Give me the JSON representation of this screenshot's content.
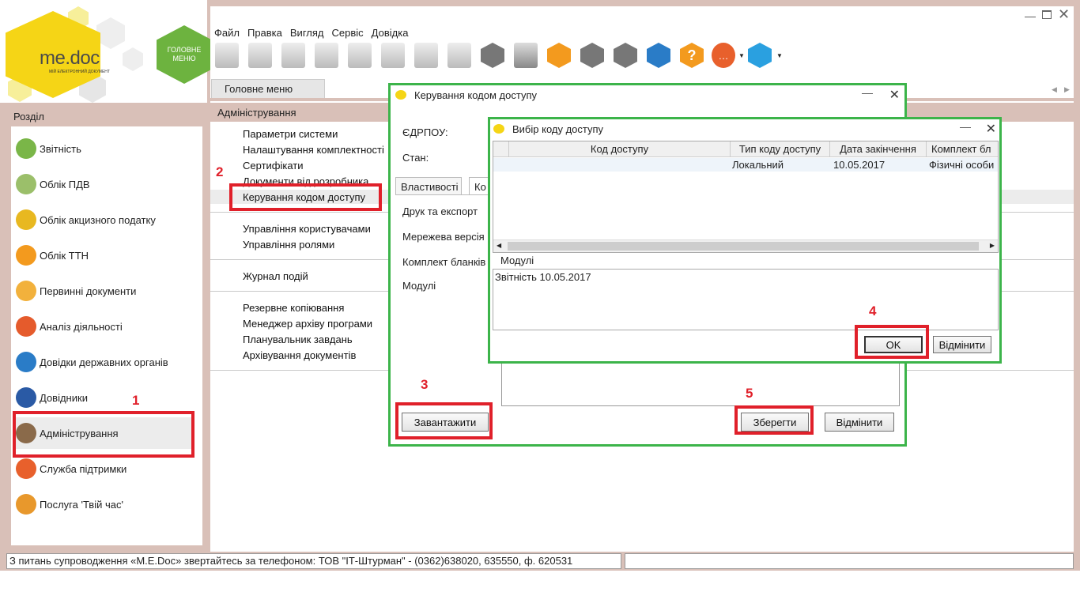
{
  "logo": {
    "brand": "me.doc",
    "tagline": "МІЙ ЕЛЕКТРОННИЙ ДОКУМЕНТ"
  },
  "main_menu_badge": [
    "ГОЛОВНЕ",
    "МЕНЮ"
  ],
  "menubar": [
    "Файл",
    "Правка",
    "Вигляд",
    "Сервіс",
    "Довідка"
  ],
  "tabs": {
    "active": "Головне меню"
  },
  "sidebar": {
    "title": "Розділ",
    "items": [
      {
        "label": "Звітність",
        "color": "#7ab648"
      },
      {
        "label": "Облік ПДВ",
        "color": "#9bbf6a"
      },
      {
        "label": "Облік акцизного податку",
        "color": "#e8b820"
      },
      {
        "label": "Облік ТТН",
        "color": "#f39a1e"
      },
      {
        "label": "Первинні документи",
        "color": "#f2b13c"
      },
      {
        "label": "Аналіз діяльності",
        "color": "#e55b2c"
      },
      {
        "label": "Довідки державних органів",
        "color": "#2a7cc7"
      },
      {
        "label": "Довідники",
        "color": "#2a5aa5"
      },
      {
        "label": "Адміністрування",
        "color": "#8a6a4a"
      },
      {
        "label": "Служба підтримки",
        "color": "#e8602c"
      },
      {
        "label": "Послуга 'Твій час'",
        "color": "#e8982c"
      }
    ]
  },
  "section": {
    "title": "Адміністрування",
    "group1": [
      "Параметри системи",
      "Налаштування комплектності",
      "Сертифікати",
      "Документи від розробника",
      "Керування кодом доступу"
    ],
    "group2": [
      "Управління користувачами",
      "Управління ролями"
    ],
    "group3": [
      "Журнал подій"
    ],
    "group4": [
      "Резервне копіювання",
      "Менеджер архіву програми",
      "Планувальник завдань",
      "Архівування документів"
    ]
  },
  "dialog_access": {
    "title": "Керування кодом доступу",
    "edrpou_label": "ЄДРПОУ:",
    "state_label": "Стан:",
    "tabs": [
      "Властивості",
      "Ко"
    ],
    "fields": [
      "Друк та експорт",
      "Мережева версія",
      "Комплект бланків",
      "Модулі"
    ],
    "load_button": "Завантажити",
    "save_button": "Зберегти",
    "cancel_button": "Відмінити"
  },
  "dialog_pick": {
    "title": "Вибір коду доступу",
    "columns": [
      "Код доступу",
      "Тип коду доступу",
      "Дата закінчення",
      "Комплект бл"
    ],
    "rows": [
      {
        "code": "",
        "type": "Локальний",
        "date": "10.05.2017",
        "kit": "Фізичні особи"
      }
    ],
    "modules_label": "Модулі",
    "modules_text": "Звітність 10.05.2017",
    "ok_button": "OK",
    "cancel_button": "Відмінити"
  },
  "annotations": [
    "1",
    "2",
    "3",
    "4",
    "5"
  ],
  "statusbar": {
    "text": "З питань супроводження «M.E.Doc» звертайтесь за телефоном: ТОВ \"ІТ-Штурман\" - (0362)638020, 635550, ф. 620531"
  },
  "colors": {
    "accent_green": "#3cb44a",
    "highlight_red": "#e0202a",
    "logo_yellow": "#f5d516",
    "panel_bg": "#d9c0b8"
  }
}
